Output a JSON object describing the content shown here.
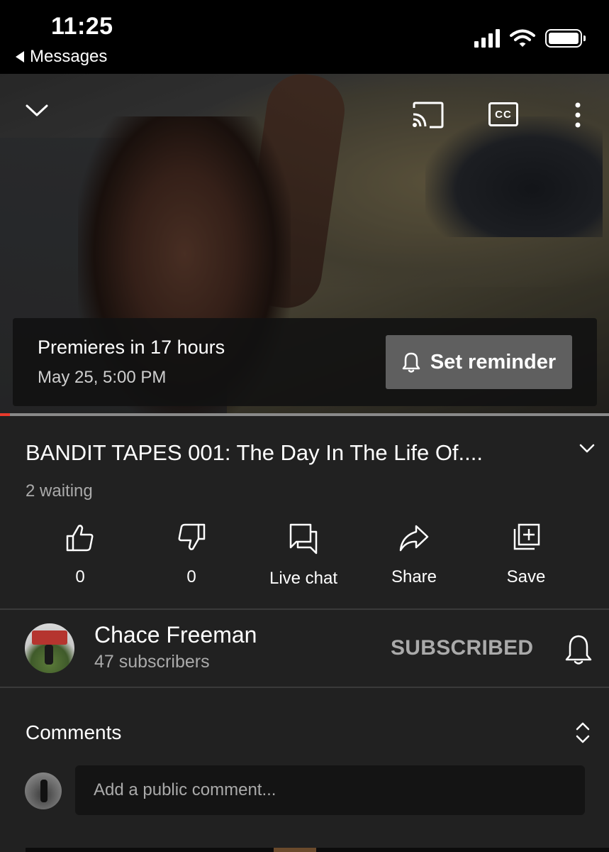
{
  "status_bar": {
    "time": "11:25",
    "back_app": "Messages"
  },
  "video": {
    "premiere_title": "Premieres in 17 hours",
    "premiere_date": "May 25, 5:00 PM",
    "reminder_label": "Set reminder",
    "cc_label": "CC"
  },
  "info": {
    "title": "BANDIT TAPES 001: The Day In The Life Of....",
    "waiting": "2 waiting"
  },
  "actions": {
    "like_count": "0",
    "dislike_count": "0",
    "live_chat": "Live chat",
    "share": "Share",
    "save": "Save"
  },
  "channel": {
    "name": "Chace Freeman",
    "subscribers": "47 subscribers",
    "subscribe_state": "SUBSCRIBED"
  },
  "comments": {
    "label": "Comments",
    "placeholder": "Add a public comment..."
  },
  "colors": {
    "background": "#212121",
    "status_bar": "#000000",
    "secondary_text": "#aaaaaa",
    "reminder_button": "#5f5f5f",
    "progress_accent": "#e83a2c"
  }
}
